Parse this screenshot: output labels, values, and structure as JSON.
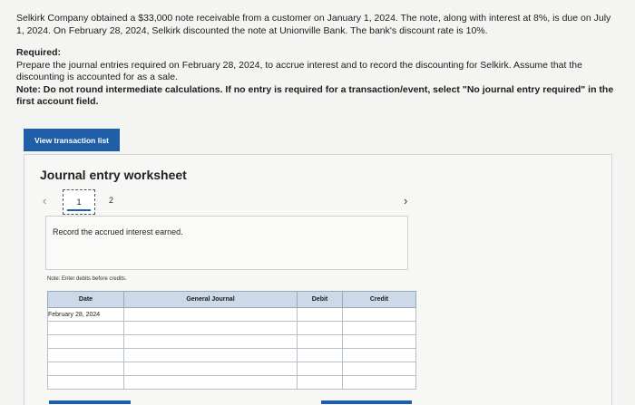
{
  "problem": {
    "paragraph": "Selkirk Company obtained a $33,000 note receivable from a customer on January 1, 2024. The note, along with interest at 8%, is due on July 1, 2024. On February 28, 2024, Selkirk discounted the note at Unionville Bank. The bank's discount rate is 10%.",
    "required_heading": "Required:",
    "required_text": "Prepare the journal entries required on February 28, 2024, to accrue interest and to record the discounting for Selkirk. Assume that the discounting is accounted for as a sale.",
    "note": "Note: Do not round intermediate calculations. If no entry is required for a transaction/event, select \"No journal entry required\" in the first account field."
  },
  "buttons": {
    "view_transactions": "View transaction list"
  },
  "worksheet": {
    "title": "Journal entry worksheet",
    "prev_icon": "‹",
    "next_icon": "›",
    "pages": [
      "1",
      "2"
    ],
    "instruction": "Record the accrued interest earned.",
    "note": "Note: Enter debits before credits."
  },
  "table": {
    "headers": {
      "date": "Date",
      "general_journal": "General Journal",
      "debit": "Debit",
      "credit": "Credit"
    },
    "rows": [
      {
        "date": "February 28, 2024"
      },
      {
        "date": ""
      },
      {
        "date": ""
      },
      {
        "date": ""
      },
      {
        "date": ""
      },
      {
        "date": ""
      }
    ]
  },
  "colors": {
    "accent": "#1f5fa8",
    "header_bg": "#ccd9e8"
  }
}
